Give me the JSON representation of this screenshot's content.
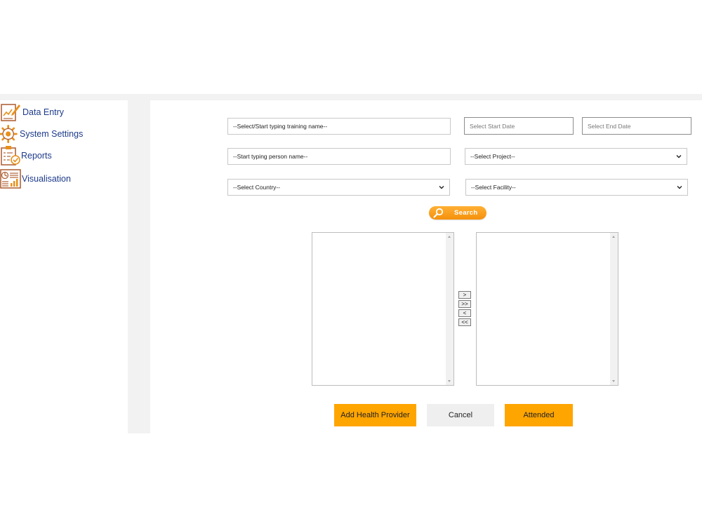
{
  "sidebar": {
    "items": [
      {
        "label": "Data Entry",
        "icon": "data-entry-icon"
      },
      {
        "label": "System Settings",
        "icon": "gear-icon"
      },
      {
        "label": "Reports",
        "icon": "report-clipboard-icon"
      },
      {
        "label": "Visualisation",
        "icon": "dashboard-chart-icon"
      }
    ]
  },
  "filters": {
    "training_name": "--Select/Start typing training name--",
    "start_date": "Select Start Date",
    "end_date": "Select End Date",
    "person_name": "--Start typing person name--",
    "project": "--Select Project--",
    "country": "--Select Country--",
    "facility": "--Select Facility--"
  },
  "search": {
    "label": "Search",
    "icon": "search-icon"
  },
  "transfer": {
    "move_one_right": ">",
    "move_all_right": ">>",
    "move_one_left": "<",
    "move_all_left": "<<"
  },
  "actions": {
    "add_health_provider": "Add Health Provider",
    "cancel": "Cancel",
    "attended": "Attended"
  },
  "colors": {
    "accent": "#ffa500",
    "sidebar_text": "#1d3a8a",
    "icon_orange": "#e8901a",
    "icon_brown": "#b0643a",
    "panel_bg": "#f2f2f2"
  }
}
